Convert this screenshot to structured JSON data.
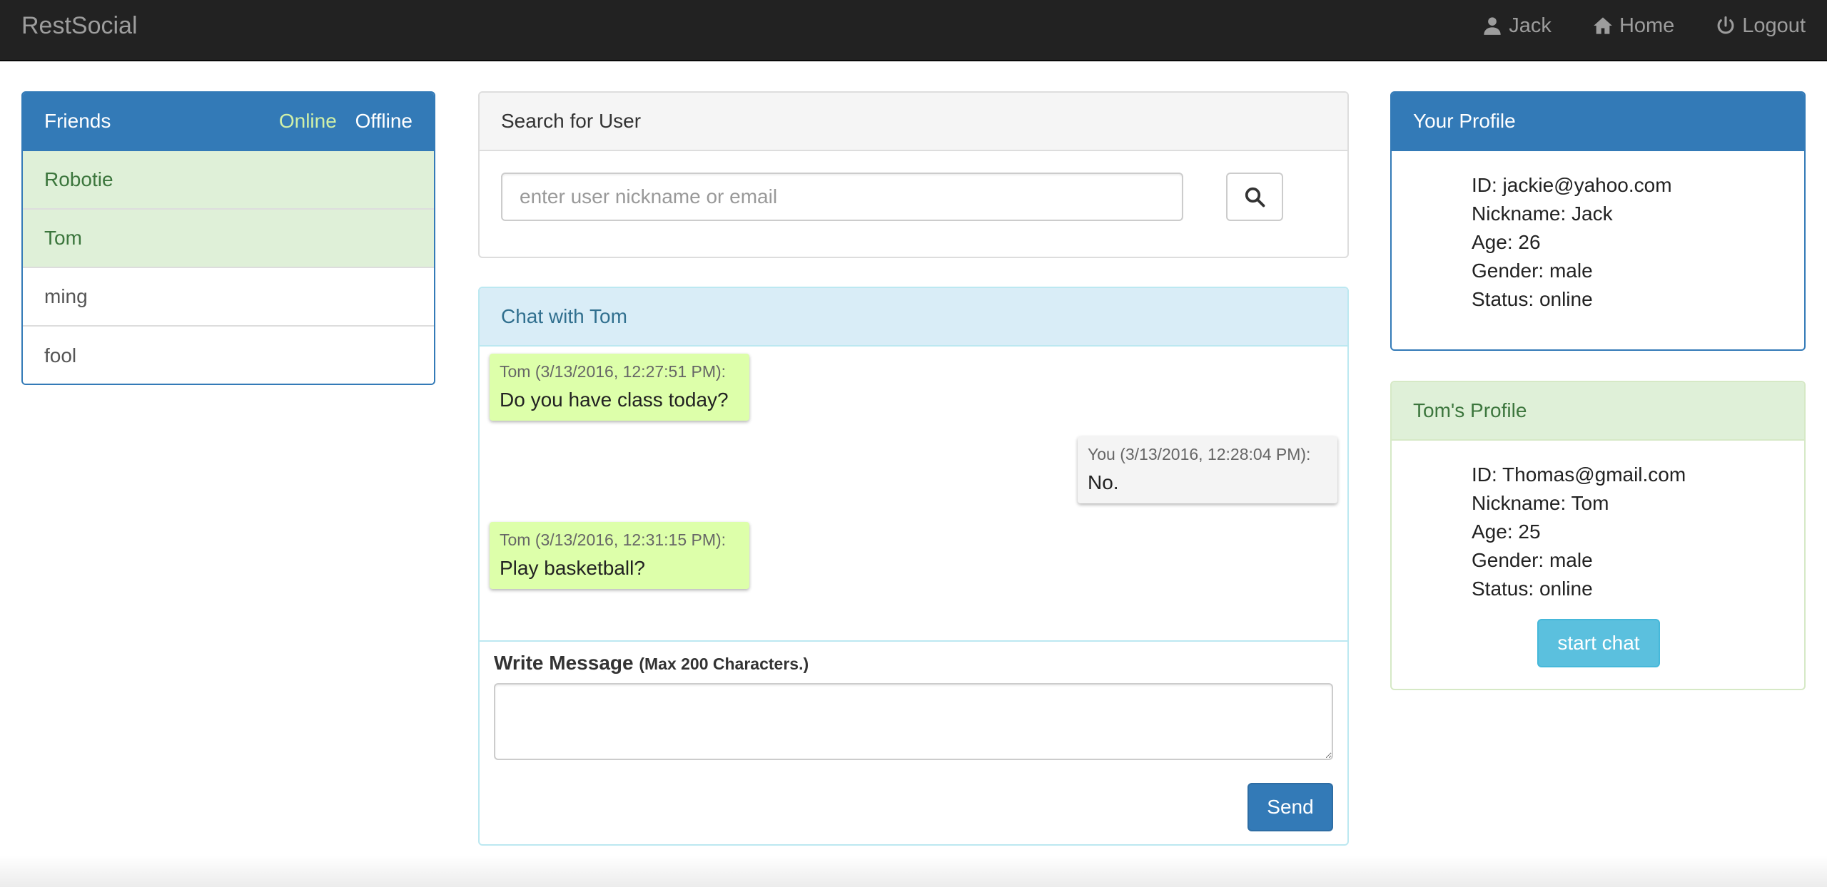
{
  "navbar": {
    "brand": "RestSocial",
    "user_label": "Jack",
    "home_label": "Home",
    "logout_label": "Logout",
    "icons": [
      "user-icon",
      "home-icon",
      "power-icon"
    ]
  },
  "friends": {
    "title": "Friends",
    "online_label": "Online",
    "offline_label": "Offline",
    "items": [
      {
        "name": "Robotie",
        "status": "online"
      },
      {
        "name": "Tom",
        "status": "online"
      },
      {
        "name": "ming",
        "status": "offline"
      },
      {
        "name": "fool",
        "status": "offline"
      }
    ]
  },
  "search": {
    "title": "Search for User",
    "placeholder": "enter user nickname or email",
    "icon": "search-icon"
  },
  "chat": {
    "title": "Chat with Tom",
    "messages": [
      {
        "sender": "Tom",
        "meta": "Tom (3/13/2016, 12:27:51 PM):",
        "text": "Do you have class today?"
      },
      {
        "sender": "You",
        "meta": "You (3/13/2016, 12:28:04 PM):",
        "text": "No."
      },
      {
        "sender": "Tom",
        "meta": "Tom (3/13/2016, 12:31:15 PM):",
        "text": "Play basketball?"
      }
    ],
    "write_label": "Write Message",
    "write_hint": "(Max 200 Characters.)",
    "message_value": "",
    "send_label": "Send"
  },
  "your_profile": {
    "title": "Your Profile",
    "lines": [
      "ID: jackie@yahoo.com",
      "Nickname: Jack",
      "Age: 26",
      "Gender: male",
      "Status: online"
    ]
  },
  "toms_profile": {
    "title": "Tom's Profile",
    "lines": [
      "ID: Thomas@gmail.com",
      "Nickname: Tom",
      "Age: 25",
      "Gender: male",
      "Status: online"
    ],
    "start_chat_label": "start chat"
  },
  "colors": {
    "navbar": "#222222",
    "primary": "#337ab7",
    "online_bg": "#dff0d8",
    "online_text": "#3c763d",
    "chat_heading": "#d9edf7",
    "their_message": "#ddffaa",
    "my_message": "#f4f4f4",
    "info_button": "#5bc0de"
  }
}
